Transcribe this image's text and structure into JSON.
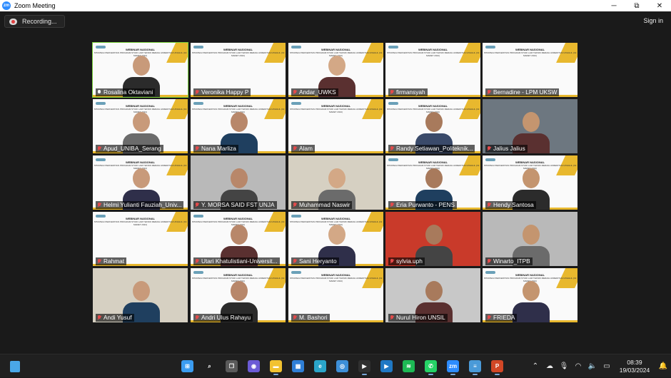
{
  "window": {
    "title": "Zoom Meeting",
    "minimize": "─",
    "maximize": "⧉",
    "close": "✕"
  },
  "recording": {
    "label": "Recording..."
  },
  "signin": {
    "label": "Sign in"
  },
  "slide_text": {
    "heading": "WEBINAR NASIONAL",
    "subtitle": "STRATEGI PERCEPATAN PROGRAM STUDI LAM TEKNIK MERAIH AKREDITASI UNGGUL",
    "date": "(19 MARET 2024)"
  },
  "participants": [
    {
      "name": "Rosalina Oktaviani",
      "type": "slide-person",
      "muted": false,
      "active": true
    },
    {
      "name": "Veronika Happy P",
      "type": "slide",
      "muted": true
    },
    {
      "name": "Andar_UWKS",
      "type": "slide-person",
      "muted": true
    },
    {
      "name": "firmansyah",
      "type": "slide",
      "muted": true
    },
    {
      "name": "Bernadine - LPM UKSW",
      "type": "slide",
      "muted": true
    },
    {
      "name": "Apud_UNIBA_Serang",
      "type": "slide-person",
      "muted": true
    },
    {
      "name": "Nana Marliza",
      "type": "slide-person",
      "muted": true
    },
    {
      "name": "Alam",
      "type": "slide",
      "muted": true
    },
    {
      "name": "Randy Setiawan_Politeknik...",
      "type": "slide-person",
      "muted": true
    },
    {
      "name": "Jalius Jalius",
      "type": "camera",
      "muted": true
    },
    {
      "name": "Helmi Yulianti Fauziah_Univ...",
      "type": "slide-person",
      "muted": true
    },
    {
      "name": "Y. MORSA SAID FST UNJA",
      "type": "camera",
      "muted": true
    },
    {
      "name": "Muhammad Naswir",
      "type": "camera",
      "muted": true
    },
    {
      "name": "Eria Purwanto - PENS",
      "type": "slide-person",
      "muted": true
    },
    {
      "name": "Hendy Santosa",
      "type": "slide-person",
      "muted": true
    },
    {
      "name": "Rahmat",
      "type": "slide",
      "muted": true
    },
    {
      "name": "Utari Khatulistiani-Universit...",
      "type": "slide-person",
      "muted": true
    },
    {
      "name": "Sani Heryanto",
      "type": "slide-person",
      "muted": true
    },
    {
      "name": "sylvia.uph",
      "type": "camera",
      "muted": true
    },
    {
      "name": "Winarto_ITPB",
      "type": "camera",
      "muted": true
    },
    {
      "name": "Andi Yusuf",
      "type": "camera",
      "muted": true
    },
    {
      "name": "Andri Ulus Rahayu",
      "type": "slide-person",
      "muted": true
    },
    {
      "name": "M. Bashori",
      "type": "slide",
      "muted": true
    },
    {
      "name": "Nurul Hiron UNSIL",
      "type": "camera",
      "muted": true
    },
    {
      "name": "FRIEDA",
      "type": "slide-person",
      "muted": true
    }
  ],
  "taskbar": {
    "apps": [
      {
        "icon": "windows-start-icon",
        "color": "#3b9cf0",
        "glyph": "⊞"
      },
      {
        "icon": "search-icon",
        "color": "#202020",
        "glyph": "⌕"
      },
      {
        "icon": "task-view-icon",
        "color": "#5a5a5a",
        "glyph": "❐"
      },
      {
        "icon": "meet-icon",
        "color": "#6b5bd6",
        "glyph": "◉"
      },
      {
        "icon": "file-explorer-icon",
        "color": "#f2c230",
        "glyph": "▬"
      },
      {
        "icon": "store-icon",
        "color": "#2f7fd6",
        "glyph": "▦"
      },
      {
        "icon": "edge-icon",
        "color": "#2aa5c9",
        "glyph": "e"
      },
      {
        "icon": "chrome-icon",
        "color": "#3d8fd8",
        "glyph": "◎"
      },
      {
        "icon": "media-player-icon",
        "color": "#303030",
        "glyph": "▶"
      },
      {
        "icon": "movies-icon",
        "color": "#1f78c4",
        "glyph": "▶"
      },
      {
        "icon": "spotify-icon",
        "color": "#1db954",
        "glyph": "≋"
      },
      {
        "icon": "whatsapp-icon",
        "color": "#25d366",
        "glyph": "✆"
      },
      {
        "icon": "zoom-icon",
        "color": "#2d8cff",
        "glyph": "zm"
      },
      {
        "icon": "notepad-icon",
        "color": "#4a9ad8",
        "glyph": "≡"
      },
      {
        "icon": "powerpoint-icon",
        "color": "#d24726",
        "glyph": "P"
      }
    ],
    "time": "08:39",
    "date": "19/03/2024"
  }
}
